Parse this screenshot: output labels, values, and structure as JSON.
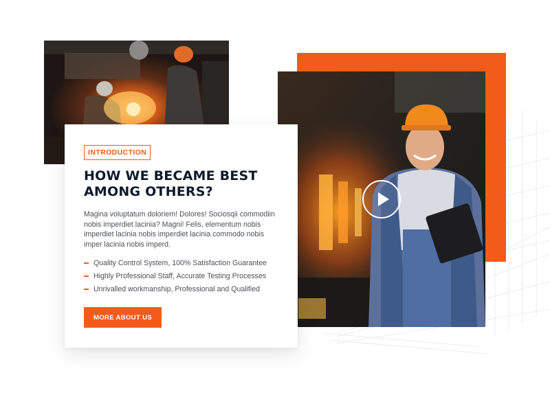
{
  "colors": {
    "accent": "#f35b1a",
    "heading": "#0f1a2c",
    "text": "#4b4f57"
  },
  "images": {
    "top_left": "workers-in-foundry-photo",
    "main": "smiling-worker-with-clipboard-photo"
  },
  "card": {
    "badge": "INTRODUCTION",
    "title_line1": "HOW WE BECAME BEST",
    "title_line2": "AMONG OTHERS?",
    "description": "Magina voluptatum doloriem! Dolores! Sociosqii commodiin nobis imperdiet lacinia? Magni! Felis, elementum nobis imperdiet lacinia nobis imperdiet lacinia commodo nobis imper lacinia nobis imperd.",
    "bullets": [
      "Quality Control System, 100% Satisfaction Guarantee",
      "Highly Professional Staff, Accurate Testing Processes",
      "Unrivalled workmanship, Professional and Qualified"
    ],
    "button_label": "MORE ABOUT US"
  },
  "video": {
    "icon": "play-icon"
  }
}
